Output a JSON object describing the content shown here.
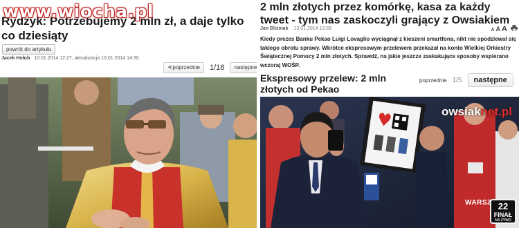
{
  "watermark": "www.wiocha.pl",
  "left": {
    "title": "Rydzyk: Potrzebujemy 2 mln zł, a daje tylko co dziesiąty",
    "back_button": "powrót do artykułu",
    "author": "Jacek Hołub",
    "date": "10.01.2014 12:27",
    "updated": ", aktualizacja 10.01.2014 14:30",
    "pager": {
      "prev": "poprzednie",
      "count": "1/18",
      "next": "następne"
    }
  },
  "right": {
    "title": "2 mln złotych przez komórkę, kasa za każdy tweet - tym nas zaskoczyli grający z Owsiakiem",
    "author": "Jan Bliźniak",
    "date": "13.01.2014 13:39",
    "tools": {
      "font_small": "A",
      "font_medium": "A",
      "font_large": "A"
    },
    "lead": "Kiedy prezes Banku Pekao Luigi Lovaglio wyciągnął z kieszeni smartfona, nikt nie spodziewał się takiego obrotu sprawy. Wkrótce ekspresowym przelewem przekazał na konto Wielkiej Orkiestry Świątecznej Pomocy 2 mln złotych. Sprawdź, na jakie jeszcze zaskakujące sposoby wspierano wczoraj WOŚP.",
    "subtitle": "Ekspresowy przelew: 2 mln złotych od Pekao",
    "pager": {
      "prev": "poprzednie",
      "count": "1/5",
      "next": "następne"
    },
    "photo": {
      "logo_main": "owsiak",
      "logo_accent": "net.pl",
      "city": "WARSZAWA",
      "final_number": "22",
      "final_label": "FINAŁ",
      "final_sub": "NA ŻYWO"
    }
  },
  "colors": {
    "watermark_outline": "#c02020",
    "owsiak_accent": "#e03030",
    "chasuble_red": "#c8322a",
    "chasuble_gold": "#d9b44a"
  },
  "icons": {
    "print": "printer-icon",
    "prev_arrow": "chevron-left-icon",
    "next_arrow": "chevron-right-icon"
  }
}
